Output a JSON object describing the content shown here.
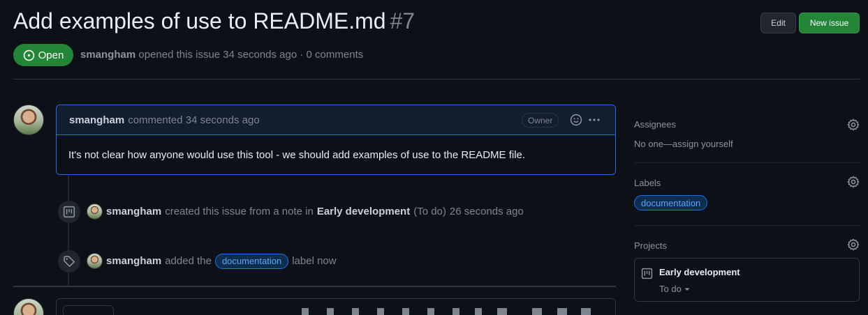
{
  "issue": {
    "title": "Add examples of use to README.md",
    "number": "#7",
    "state": "Open",
    "author": "smangham",
    "opened_text": "opened this issue 34 seconds ago · 0 comments"
  },
  "header": {
    "edit_label": "Edit",
    "new_issue_label": "New issue"
  },
  "comment": {
    "author": "smangham",
    "meta": "commented 34 seconds ago",
    "badge": "Owner",
    "body": "It's not clear how anyone would use this tool - we should add examples of use to the README file."
  },
  "timeline": {
    "event1": {
      "author": "smangham",
      "text_pre": "created this issue from a note in",
      "project": "Early development",
      "column": "(To do)",
      "time": "26 seconds ago"
    },
    "event2": {
      "author": "smangham",
      "text_pre": "added the",
      "label": "documentation",
      "text_post": "label now"
    }
  },
  "sidebar": {
    "assignees": {
      "heading": "Assignees",
      "value": "No one—assign yourself"
    },
    "labels": {
      "heading": "Labels",
      "value": "documentation"
    },
    "projects": {
      "heading": "Projects",
      "name": "Early development",
      "column": "To do"
    }
  },
  "colors": {
    "background": "#0d1117",
    "accent_green": "#238636",
    "accent_blue": "#1f6feb",
    "label_text": "#58a6ff"
  },
  "icons": {
    "state": "issue-opened-icon",
    "settings": "gear-icon",
    "project": "project-icon",
    "label": "tag-icon",
    "reaction": "smiley-icon",
    "more": "kebab-horizontal-icon"
  }
}
